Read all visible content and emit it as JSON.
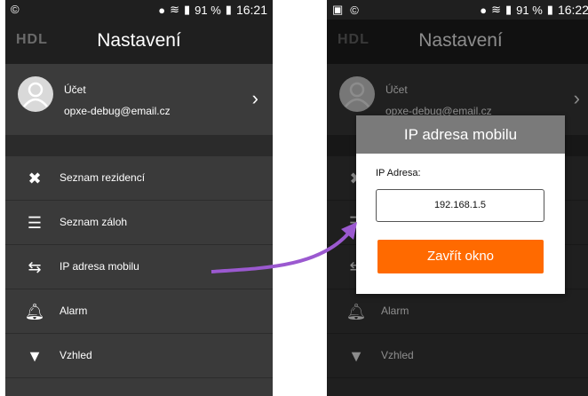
{
  "left_screen": {
    "status": {
      "time": "16:21",
      "battery": "91 %"
    },
    "logo": "HDL",
    "title": "Nastavení",
    "account": {
      "label": "Účet",
      "email": "opxe-debug@email.cz"
    },
    "menu": [
      {
        "label": "Seznam rezidencí",
        "icon": "tools-icon"
      },
      {
        "label": "Seznam záloh",
        "icon": "layers-icon"
      },
      {
        "label": "IP adresa mobilu",
        "icon": "swap-arrows-icon"
      },
      {
        "label": "Alarm",
        "icon": "bell-icon"
      },
      {
        "label": "Vzhled",
        "icon": "shirt-icon"
      }
    ]
  },
  "right_screen": {
    "status": {
      "time": "16:22",
      "battery": "91 %"
    },
    "logo": "HDL",
    "title": "Nastavení",
    "account": {
      "label": "Účet",
      "email": "opxe-debug@email.cz"
    },
    "menu": [
      {
        "label": "Alarm",
        "icon": "bell-icon"
      },
      {
        "label": "Vzhled",
        "icon": "shirt-icon"
      }
    ],
    "dialog": {
      "title": "IP adresa mobilu",
      "field_label": "IP Adresa:",
      "field_value": "192.168.1.5",
      "button_label": "Zavřít okno"
    }
  },
  "colors": {
    "accent": "#ff6a00",
    "arrow": "#9b59d0",
    "header": "#1f1f1f",
    "background": "#3a3a3a"
  }
}
